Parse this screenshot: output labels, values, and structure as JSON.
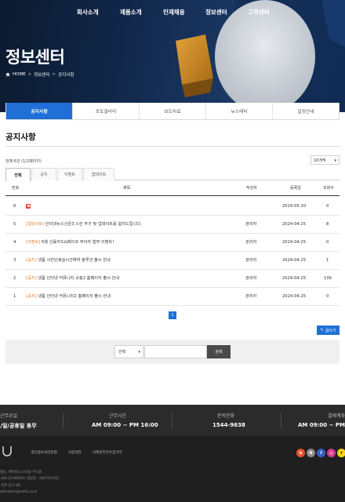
{
  "nav": [
    "회사소개",
    "제품소개",
    "인재채용",
    "정보센터",
    "고객센터"
  ],
  "hero": {
    "title": "정보센터",
    "breadcrumb": [
      "HOME",
      "정보센터",
      "공지사항"
    ]
  },
  "subtabs": [
    {
      "label": "공지사항",
      "active": true
    },
    {
      "label": "포토갤러리",
      "active": false
    },
    {
      "label": "보도자료",
      "active": false
    },
    {
      "label": "뉴스레터",
      "active": false
    },
    {
      "label": "일정안내",
      "active": false
    }
  ],
  "section_title": "공지사항",
  "total_text": "전체 6건 (1/1페이지)",
  "per_page": "10개씩",
  "category_tabs": [
    {
      "label": "전체",
      "active": true
    },
    {
      "label": "공지",
      "active": false
    },
    {
      "label": "이벤트",
      "active": false
    },
    {
      "label": "업데이트",
      "active": false
    }
  ],
  "table": {
    "headers": [
      "번호",
      "제목",
      "작성자",
      "등록일",
      "조회수"
    ],
    "rows": [
      {
        "num": "6",
        "tag": "",
        "title": "",
        "author": "",
        "date": "2024-05-20",
        "views": "0",
        "image_icon": true
      },
      {
        "num": "5",
        "tag": "[업데이트]",
        "title": "인터넷뉴스신문3 스킨 추가 및 업데이트를 알려드립니다.",
        "author": "관리자",
        "date": "2024-04-25",
        "views": "8"
      },
      {
        "num": "4",
        "tag": "[이벤트]",
        "title": "6월 신용카드&페이코 무이자 할부 이벤트!",
        "author": "관리자",
        "date": "2024-04-25",
        "views": "0"
      },
      {
        "num": "3",
        "tag": "[공지]",
        "title": "넷폼 사진인쇄실시간예약 솔루션 출시 안내",
        "author": "관리자",
        "date": "2024-04-25",
        "views": "1"
      },
      {
        "num": "2",
        "tag": "[공지]",
        "title": "넷폼 인터넷 커뮤니티 쇼핑2 홈페이지 출시 안내",
        "author": "관리자",
        "date": "2024-04-25",
        "views": "136"
      },
      {
        "num": "1",
        "tag": "[공지]",
        "title": "넷폼 인터넷 커뮤니티2 홈페이지 출시 안내",
        "author": "관리자",
        "date": "2024-04-25",
        "views": "0"
      }
    ]
  },
  "pagination": {
    "current": "1"
  },
  "write_button": "글쓰기",
  "search": {
    "select": "선택",
    "button": "검색",
    "input_value": ""
  },
  "footer_info": [
    {
      "label": "근무요일",
      "value": "토/일/공휴일 휴무"
    },
    {
      "label": "근무시간",
      "value": "AM 09:00 ~ PM 16:00"
    },
    {
      "label": "문의전화",
      "value": "1544-9638"
    },
    {
      "label": "결제계좌",
      "value": "AM 09:00 ~ PM 1"
    }
  ],
  "footer": {
    "links": [
      "개인정보처리방침",
      "이용약관",
      "이메일무단수집거부"
    ],
    "address_lines": [
      "빌딩, 케이린도시사업) 주식회",
      "-4(6-14-86591) 설립일 : 2007/07/02",
      "-광주 동구-46",
      "ebmaster@netfu.co.kr"
    ],
    "socials": [
      {
        "name": "blog",
        "color": "#e8532c",
        "glyph": "b"
      },
      {
        "name": "news",
        "color": "#8b8b8b",
        "glyph": "N"
      },
      {
        "name": "facebook",
        "color": "#3b5ec9",
        "glyph": "f"
      },
      {
        "name": "instagram",
        "color": "#d63a8f",
        "glyph": "◎"
      },
      {
        "name": "kakaotalk",
        "color": "#f5d40f",
        "glyph": "t"
      }
    ]
  }
}
